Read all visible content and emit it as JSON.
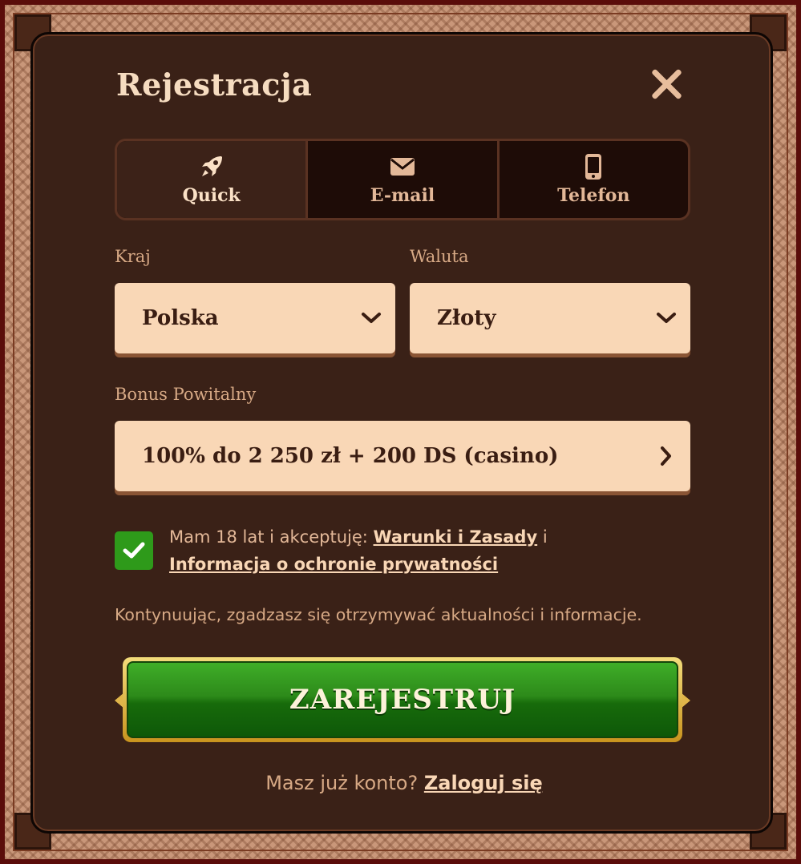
{
  "modal": {
    "title": "Rejestracja"
  },
  "tabs": [
    {
      "label": "Quick",
      "icon": "rocket-icon",
      "active": true
    },
    {
      "label": "E-mail",
      "icon": "envelope-icon",
      "active": false
    },
    {
      "label": "Telefon",
      "icon": "phone-icon",
      "active": false
    }
  ],
  "form": {
    "country_label": "Kraj",
    "country_value": "Polska",
    "currency_label": "Waluta",
    "currency_value": "Złoty",
    "bonus_label": "Bonus Powitalny",
    "bonus_value": "100% do 2 250 zł + 200 DS (casino)"
  },
  "consent": {
    "checked": true,
    "prefix": "Mam 18 lat i akceptuję: ",
    "terms_link": "Warunki i Zasady",
    "joiner": " i",
    "privacy_link": "Informacja o ochronie prywatności"
  },
  "info_text": "Kontynuując, zgadzasz się otrzymywać aktualności i informacje.",
  "register_button": "ZAREJESTRUJ",
  "login": {
    "prompt": "Masz już konto? ",
    "link": "Zaloguj się"
  },
  "colors": {
    "modal_bg": "#3a2117",
    "field_bg": "#f9d7b6",
    "accent_green": "#2e9a1a",
    "gold": "#e0b54a"
  }
}
